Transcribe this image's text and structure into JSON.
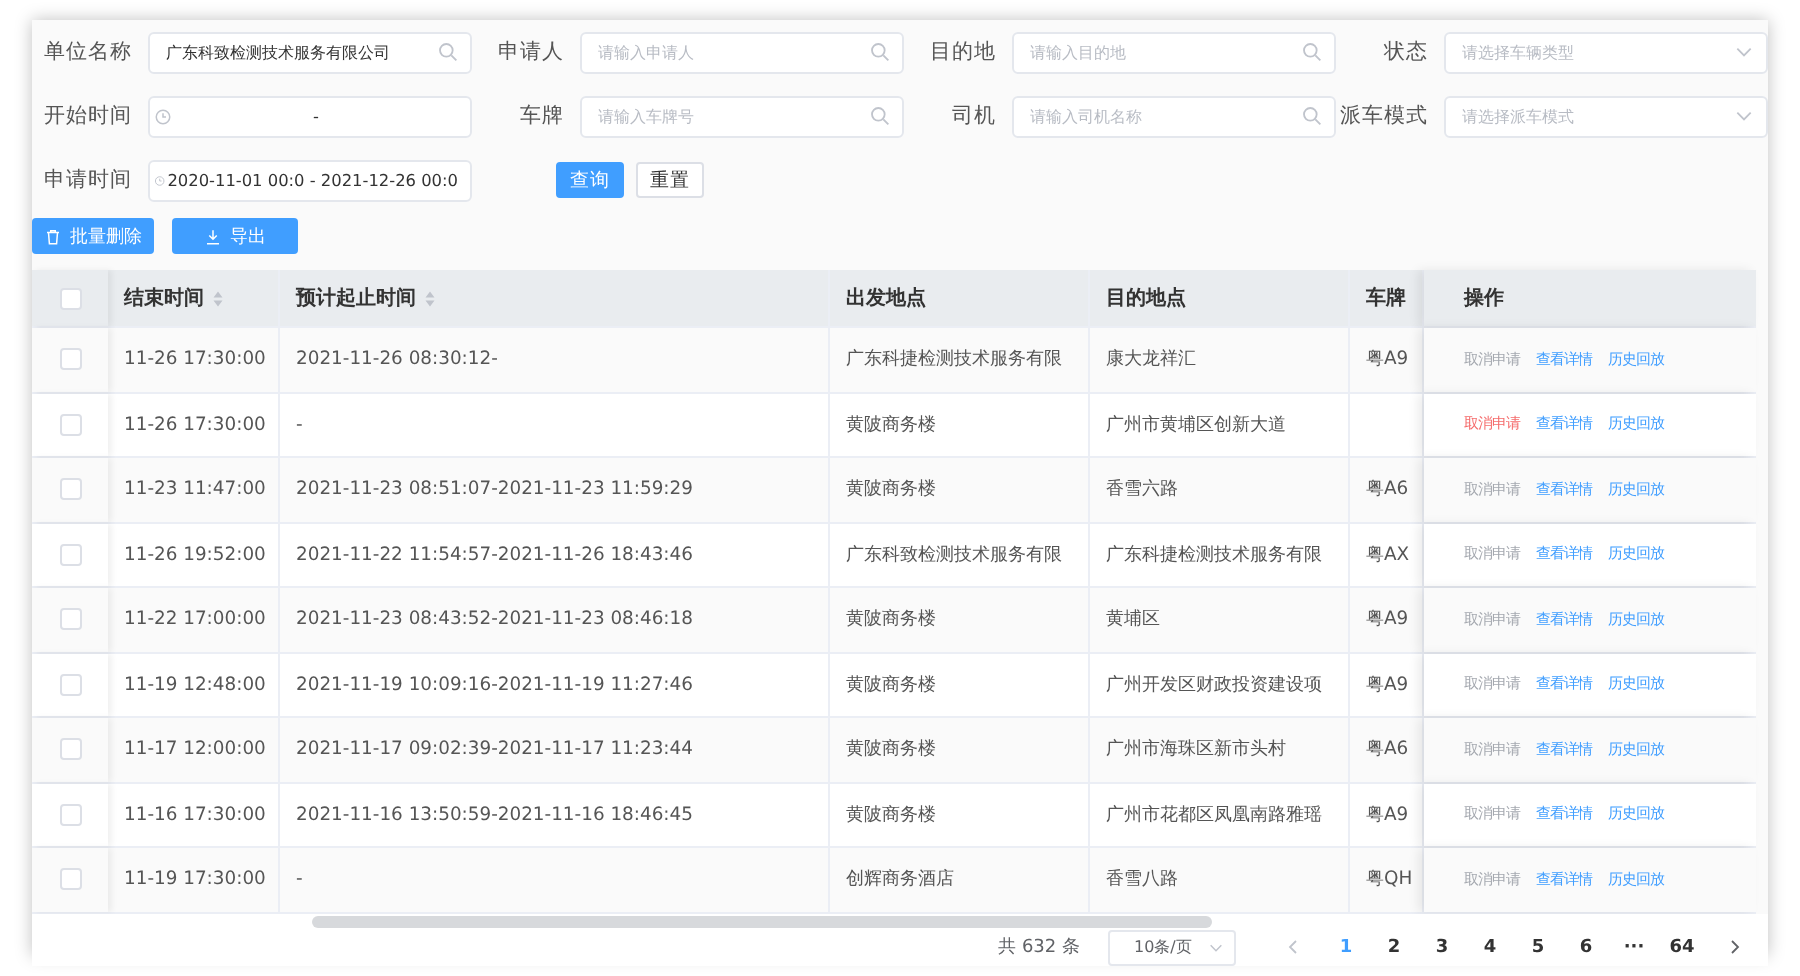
{
  "filters": [
    {
      "label": "单位名称",
      "kind": "text",
      "value": "广东科致检测技术服务有限公司"
    },
    {
      "label": "申请人",
      "kind": "text",
      "placeholder": "请输入申请人"
    },
    {
      "label": "目的地",
      "kind": "text",
      "placeholder": "请输入目的地"
    },
    {
      "label": "状态",
      "kind": "select",
      "placeholder": "请选择车辆类型"
    },
    {
      "label": "开始时间",
      "kind": "daterange",
      "value": "-"
    },
    {
      "label": "车牌",
      "kind": "text",
      "placeholder": "请输入车牌号"
    },
    {
      "label": "司机",
      "kind": "text",
      "placeholder": "请输入司机名称"
    },
    {
      "label": "派车模式",
      "kind": "select",
      "placeholder": "请选择派车模式"
    },
    {
      "label": "申请时间",
      "kind": "daterange",
      "value": "2020-11-01 00:0  -  2021-12-26 00:0"
    }
  ],
  "search_buttons": [
    {
      "label": "查询",
      "kind": "primary"
    },
    {
      "label": "重置",
      "kind": "plain"
    }
  ],
  "toolbar": [
    {
      "label": "批量删除",
      "kind": "delete"
    },
    {
      "label": "导出",
      "kind": "export"
    }
  ],
  "table": {
    "header_checked": false,
    "columns": [
      {
        "label": "结束时间",
        "sortable": true
      },
      {
        "label": "预计起止时间",
        "sortable": true
      },
      {
        "label": "出发地点",
        "sortable": false
      },
      {
        "label": "目的地点",
        "sortable": false
      },
      {
        "label": "车牌",
        "sortable": false
      },
      {
        "label": "操作",
        "sortable": false
      }
    ],
    "rows": [
      {
        "checked": false,
        "cells": [
          "11-26 17:30:00",
          "2021-11-26 08:30:12-",
          "广东科捷检测技术服务有限",
          "康大龙祥汇",
          "粤A9"
        ],
        "actions": [
          {
            "label": "取消申请",
            "disabled": true
          },
          {
            "label": "查看详情",
            "disabled": false
          },
          {
            "label": "历史回放",
            "disabled": false
          }
        ]
      },
      {
        "checked": false,
        "cells": [
          "11-26 17:30:00",
          "-",
          "黄陂商务楼",
          "广州市黄埔区创新大道",
          ""
        ],
        "actions": [
          {
            "label": "取消申请",
            "disabled": false
          },
          {
            "label": "查看详情",
            "disabled": false
          },
          {
            "label": "历史回放",
            "disabled": false
          }
        ]
      },
      {
        "checked": false,
        "cells": [
          "11-23 11:47:00",
          "2021-11-23 08:51:07-2021-11-23 11:59:29",
          "黄陂商务楼",
          "香雪六路",
          "粤A6"
        ],
        "actions": [
          {
            "label": "取消申请",
            "disabled": true
          },
          {
            "label": "查看详情",
            "disabled": false
          },
          {
            "label": "历史回放",
            "disabled": false
          }
        ]
      },
      {
        "checked": false,
        "cells": [
          "11-26 19:52:00",
          "2021-11-22 11:54:57-2021-11-26 18:43:46",
          "广东科致检测技术服务有限",
          "广东科捷检测技术服务有限",
          "粤AX"
        ],
        "actions": [
          {
            "label": "取消申请",
            "disabled": true
          },
          {
            "label": "查看详情",
            "disabled": false
          },
          {
            "label": "历史回放",
            "disabled": false
          }
        ]
      },
      {
        "checked": false,
        "cells": [
          "11-22 17:00:00",
          "2021-11-23 08:43:52-2021-11-23 08:46:18",
          "黄陂商务楼",
          "黄埔区",
          "粤A9"
        ],
        "actions": [
          {
            "label": "取消申请",
            "disabled": true
          },
          {
            "label": "查看详情",
            "disabled": false
          },
          {
            "label": "历史回放",
            "disabled": false
          }
        ]
      },
      {
        "checked": false,
        "cells": [
          "11-19 12:48:00",
          "2021-11-19 10:09:16-2021-11-19 11:27:46",
          "黄陂商务楼",
          "广州开发区财政投资建设项",
          "粤A9"
        ],
        "actions": [
          {
            "label": "取消申请",
            "disabled": true
          },
          {
            "label": "查看详情",
            "disabled": false
          },
          {
            "label": "历史回放",
            "disabled": false
          }
        ]
      },
      {
        "checked": false,
        "cells": [
          "11-17 12:00:00",
          "2021-11-17 09:02:39-2021-11-17 11:23:44",
          "黄陂商务楼",
          "广州市海珠区新市头村",
          "粤A6"
        ],
        "actions": [
          {
            "label": "取消申请",
            "disabled": true
          },
          {
            "label": "查看详情",
            "disabled": false
          },
          {
            "label": "历史回放",
            "disabled": false
          }
        ]
      },
      {
        "checked": false,
        "cells": [
          "11-16 17:30:00",
          "2021-11-16 13:50:59-2021-11-16 18:46:45",
          "黄陂商务楼",
          "广州市花都区凤凰南路雅瑶",
          "粤A9"
        ],
        "actions": [
          {
            "label": "取消申请",
            "disabled": true
          },
          {
            "label": "查看详情",
            "disabled": false
          },
          {
            "label": "历史回放",
            "disabled": false
          }
        ]
      },
      {
        "checked": false,
        "cells": [
          "11-19 17:30:00",
          "-",
          "创辉商务酒店",
          "香雪八路",
          "粤QH"
        ],
        "actions": [
          {
            "label": "取消申请",
            "disabled": true
          },
          {
            "label": "查看详情",
            "disabled": false
          },
          {
            "label": "历史回放",
            "disabled": false
          }
        ]
      }
    ]
  },
  "pagination": {
    "total": "共 632 条",
    "page_size": "10条/页",
    "pages": [
      {
        "label": "1",
        "selected": true
      },
      {
        "label": "2",
        "selected": false
      },
      {
        "label": "3",
        "selected": false
      },
      {
        "label": "4",
        "selected": false
      },
      {
        "label": "5",
        "selected": false
      },
      {
        "label": "6",
        "selected": false
      },
      {
        "label": "···",
        "selected": false
      },
      {
        "label": "64",
        "selected": false
      }
    ]
  }
}
